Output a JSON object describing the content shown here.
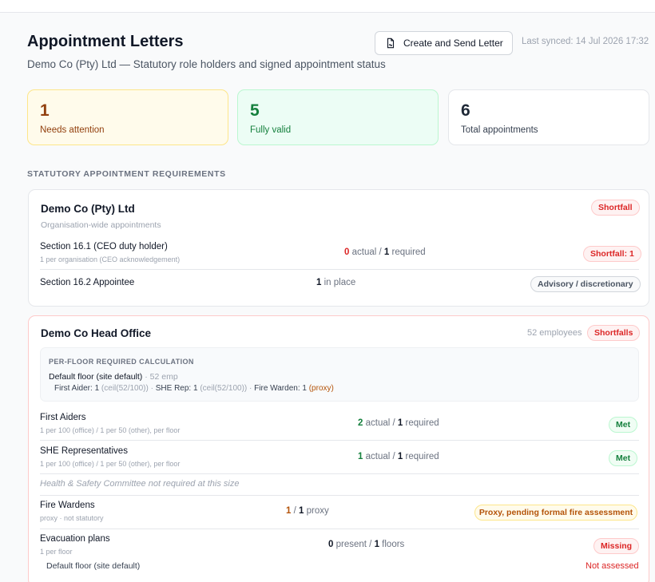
{
  "header": {
    "title": "Appointment Letters",
    "subtitle": "Demo Co (Pty) Ltd — Statutory role holders and signed appointment status",
    "button_label": "Create and Send Letter",
    "last_synced": "Last synced: 14 Jul 2026 17:32"
  },
  "stats": [
    {
      "value": "1",
      "label": "Needs attention"
    },
    {
      "value": "5",
      "label": "Fully valid"
    },
    {
      "value": "6",
      "label": "Total appointments"
    }
  ],
  "section_heading": "STATUTORY APPOINTMENT REQUIREMENTS",
  "org_card": {
    "title": "Demo Co (Pty) Ltd",
    "subtitle": "Organisation-wide appointments",
    "badge": "Shortfall",
    "rows": [
      {
        "name": "Section 16.1 (CEO duty holder)",
        "sub": "1 per organisation (CEO acknowledgement)",
        "actual": "0",
        "actual_word": "actual /",
        "required": "1",
        "required_word": "required",
        "badge": "Shortfall: 1"
      },
      {
        "name": "Section 16.2 Appointee",
        "count": "1",
        "count_word": "in place",
        "badge": "Advisory / discretionary"
      }
    ]
  },
  "site_card": {
    "title": "Demo Co Head Office",
    "employees": "52 employees",
    "badge": "Shortfalls",
    "calc": {
      "heading": "PER-FLOOR REQUIRED CALCULATION",
      "floor": "Default floor (site default)",
      "floor_emp": "· 52 emp",
      "fa_label": "First Aider:",
      "fa_val": "1",
      "fa_calc": "(ceil(52/100))",
      "sep1": "·",
      "she_label": "SHE Rep:",
      "she_val": "1",
      "she_calc": "(ceil(52/100))",
      "sep2": "·",
      "fw_label": "Fire Warden:",
      "fw_val": "1",
      "fw_proxy": "(proxy)"
    },
    "rows": [
      {
        "name": "First Aiders",
        "sub": "1 per 100 (office) / 1 per 50 (other), per floor",
        "actual": "2",
        "actual_word": "actual /",
        "required": "1",
        "required_word": "required",
        "badge": "Met"
      },
      {
        "name": "SHE Representatives",
        "sub": "1 per 100 (office) / 1 per 50 (other), per floor",
        "actual": "1",
        "actual_word": "actual /",
        "required": "1",
        "required_word": "required",
        "badge": "Met"
      }
    ],
    "note": "Health & Safety Committee not required at this size",
    "fire": {
      "name": "Fire Wardens",
      "sub": "proxy · not statutory",
      "actual": "1",
      "sep": "/",
      "required": "1",
      "word": "proxy",
      "badge": "Proxy, pending formal fire assessment"
    },
    "evac": {
      "name": "Evacuation plans",
      "sub": "1 per floor",
      "present": "0",
      "present_word": "present /",
      "floors": "1",
      "floors_word": "floors",
      "badge": "Missing",
      "floor_label": "Default floor (site default)",
      "floor_status": "Not assessed"
    }
  }
}
